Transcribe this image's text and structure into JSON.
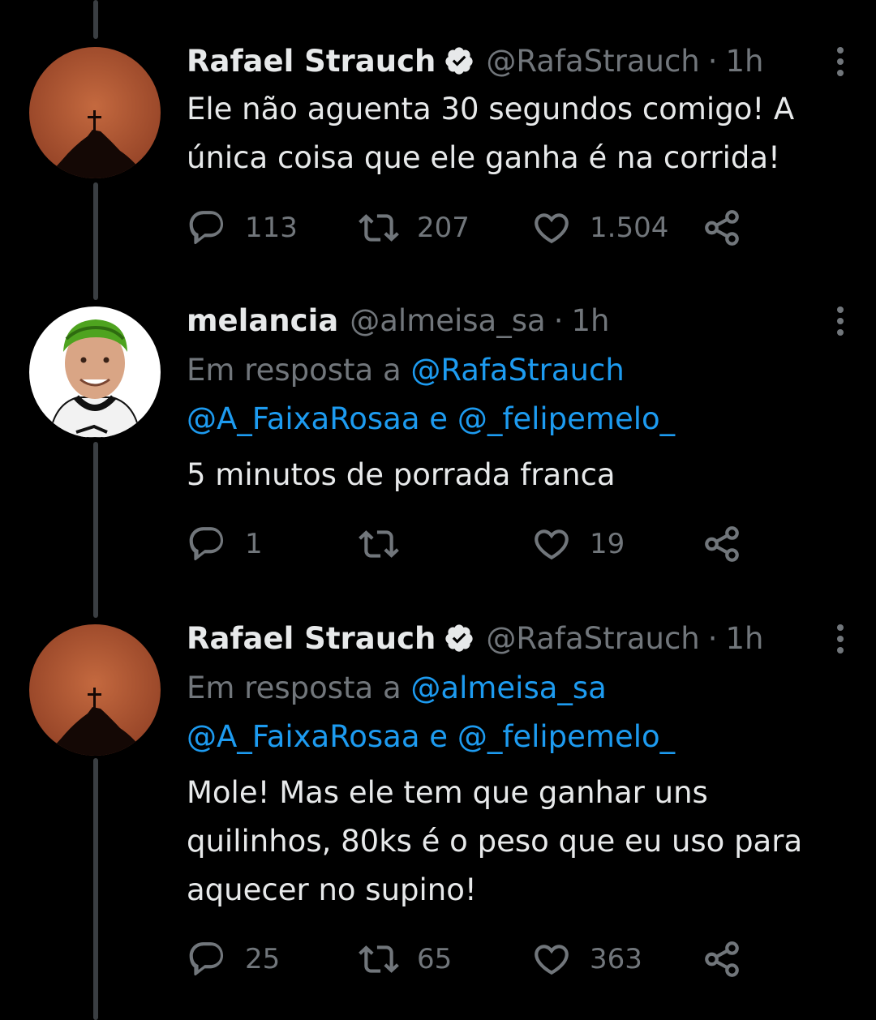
{
  "tweets": [
    {
      "name": "Rafael Strauch",
      "verified": true,
      "handle": "@RafaStrauch",
      "dot": "·",
      "time": "1h",
      "reply_prefix": "",
      "reply_to": [],
      "text_lines": [
        "Ele não aguenta 30 segundos comigo! A",
        "única coisa que ele ganha é na corrida!"
      ],
      "replies": "113",
      "retweets": "207",
      "likes": "1.504"
    },
    {
      "name": "melancia",
      "verified": false,
      "handle": "@almeisa_sa",
      "dot": "·",
      "time": "1h",
      "reply_prefix": "Em resposta a",
      "reply_to": [
        "@RafaStrauch",
        "@A_FaixaRosaa",
        "e",
        "@_felipemelo_"
      ],
      "text_lines": [
        "5 minutos de porrada franca"
      ],
      "replies": "1",
      "retweets": "",
      "likes": "19"
    },
    {
      "name": "Rafael Strauch",
      "verified": true,
      "handle": "@RafaStrauch",
      "dot": "·",
      "time": "1h",
      "reply_prefix": "Em resposta a",
      "reply_to": [
        "@almeisa_sa",
        "@A_FaixaRosaa",
        "e",
        "@_felipemelo_"
      ],
      "text_lines": [
        "Mole! Mas ele tem que ganhar uns",
        "quilinhos, 80ks é o peso que eu uso para",
        "aquecer no supino!"
      ],
      "replies": "25",
      "retweets": "65",
      "likes": "363"
    }
  ],
  "icons": {
    "reply": "reply-icon",
    "retweet": "retweet-icon",
    "like": "heart-icon",
    "share": "share-icon",
    "more": "more-icon",
    "verified": "verified-badge-icon"
  },
  "colors": {
    "background": "#000000",
    "text": "#e7e9ea",
    "muted": "#71767b",
    "link": "#1d9bf0",
    "thread_line": "#3a3e42"
  }
}
